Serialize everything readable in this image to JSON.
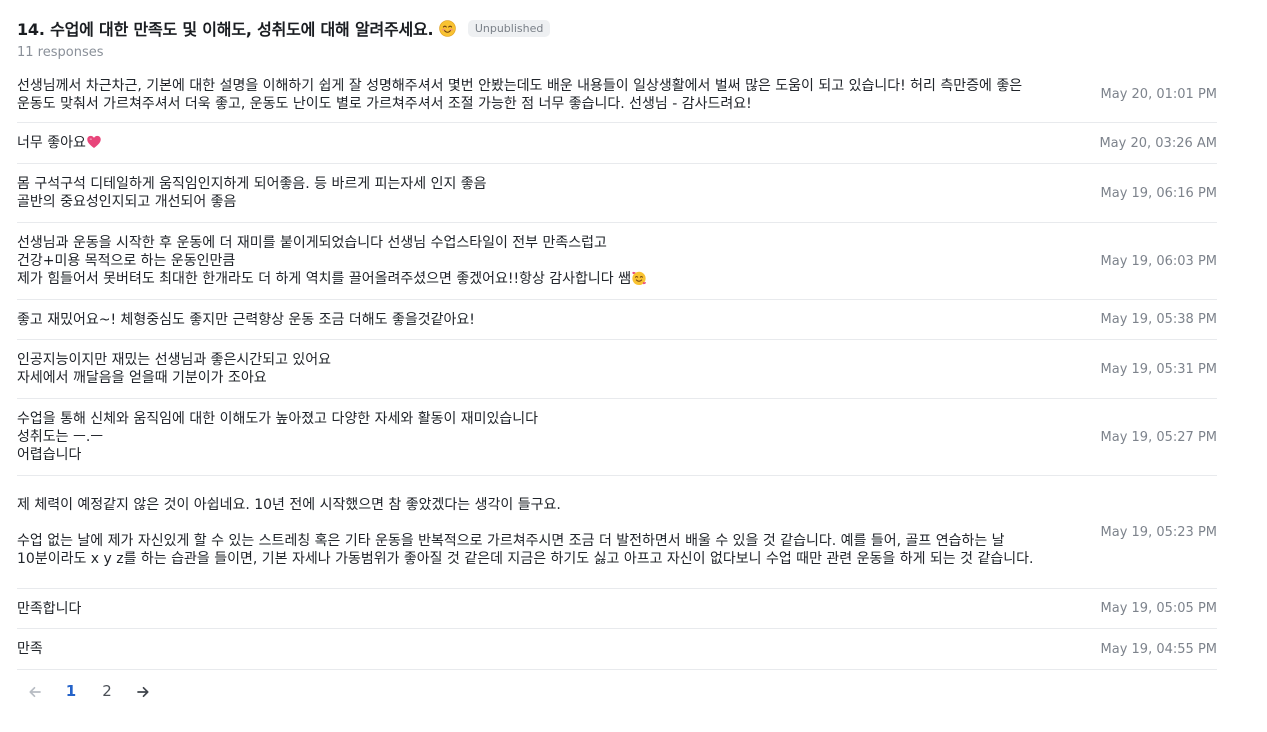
{
  "question": {
    "title": "14. 수업에 대한 만족도 및 이해도, 성취도에 대해 알려주세요.",
    "title_emoji": "smiling-face-icon",
    "status": "Unpublished",
    "response_count": "11 responses"
  },
  "responses": [
    {
      "text": "선생님께서 차근차근, 기본에 대한 설명을 이해하기 쉽게 잘 성명해주셔서 몇번 안봤는데도 배운 내용들이 일상생활에서 벌써 많은 도움이 되고 있습니다! 허리 측만증에 좋은 운동도 맞춰서 가르쳐주셔서 더욱 좋고, 운동도 난이도 별로 가르쳐주셔서 조절 가능한 점 너무 좋습니다. 선생님 - 감사드려요!",
      "time": "May 20, 01:01 PM"
    },
    {
      "text": "너무 좋아요",
      "icon": "pink-heart-icon",
      "time": "May 20, 03:26 AM"
    },
    {
      "text": "몸 구석구석 디테일하게 움직임인지하게 되어좋음. 등 바르게 피는자세 인지 좋음\n골반의 중요성인지되고 개선되어 좋음",
      "time": "May 19, 06:16 PM"
    },
    {
      "text": "선생님과 운동을 시작한 후 운동에 더 재미를 붙이게되었습니다 선생님 수업스타일이 전부 만족스럽고\n건강+미용 목적으로 하는 운동인만큼\n제가 힘들어서 못버텨도 최대한 한개라도 더 하게 역치를 끌어올려주셨으면 좋겠어요!!항상 감사합니다 쌤",
      "icon": "smiling-face-with-hearts-icon",
      "time": "May 19, 06:03 PM"
    },
    {
      "text": "좋고 재밌어요~! 체형중심도 좋지만 근력향상 운동 조금 더해도 좋을것같아요!",
      "time": "May 19, 05:38 PM"
    },
    {
      "text": "인공지능이지만 재밌는 선생님과 좋은시간되고 있어요\n자세에서 깨달음을 얻을때 기분이가 조아요",
      "time": "May 19, 05:31 PM"
    },
    {
      "text": "수업을 통해 신체와 움직임에 대한 이해도가 높아졌고 다양한 자세와 활동이 재미있습니다\n성취도는 ㅡ.ㅡ\n어렵습니다",
      "time": "May 19, 05:27 PM"
    },
    {
      "text": "제 체력이 예정같지 않은 것이 아쉽네요. 10년 전에 시작했으면 참 좋았겠다는 생각이 들구요.\n\n수업 없는 날에 제가 자신있게 할 수 있는 스트레칭 혹은 기타 운동을 반복적으로 가르쳐주시면 조금 더 발전하면서 배울 수 있을 것 같습니다. 예를 들어, 골프 연습하는 날 10분이라도 x y z를 하는 습관을 들이면, 기본 자세나 가동범위가 좋아질 것 같은데 지금은 하기도 싫고 아프고 자신이 없다보니 수업 때만 관련 운동을 하게 되는 것 같습니다.",
      "time": "May 19, 05:23 PM"
    },
    {
      "text": "만족합니다",
      "time": "May 19, 05:05 PM"
    },
    {
      "text": "만족",
      "time": "May 19, 04:55 PM"
    }
  ],
  "pagination": {
    "prev": "arrow-left-icon",
    "pages": [
      "1",
      "2"
    ],
    "current": "1",
    "next": "arrow-right-icon"
  },
  "colors": {
    "accent": "#2563c9",
    "heart": "#e8457a",
    "badge_bg": "#eef0f2"
  }
}
